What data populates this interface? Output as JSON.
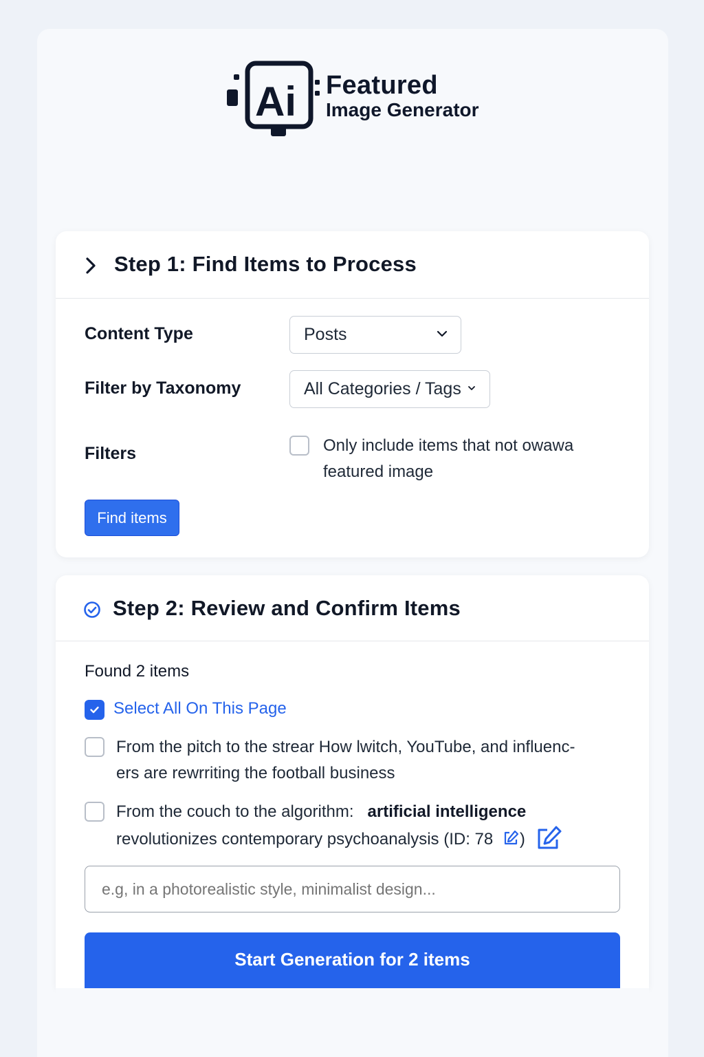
{
  "logo": {
    "line1": "Featured",
    "line2": "Image Generator",
    "mark_text": "Ai"
  },
  "step1": {
    "title": "Step 1: Find Items to Process",
    "content_type_label": "Content Type",
    "content_type_value": "Posts",
    "taxonomy_label": "Filter by Taxonomy",
    "taxonomy_value": "All Categories / Tags",
    "filters_label": "Filters",
    "filter_option_line1": "Only include items that not owawa",
    "filter_option_line2": "featured image",
    "filter_option_checked": false,
    "find_button": "Find items"
  },
  "step2": {
    "title": "Step 2: Review and Confirm Items",
    "found_text": "Found 2 items",
    "select_all_label": "Select All On This Page",
    "select_all_checked": true,
    "items": [
      {
        "line1": "From the pitch to the strear How lwitch, YouTube,  and influenc-",
        "line2": "ers are rewrriting the football business",
        "checked": false
      },
      {
        "line1_a": "From the couch to the algorithm:",
        "line1_b": "artificial intelligence",
        "line2": "revolutionizes contemporary psychoanalysis (ID: 78",
        "line2_end": ")",
        "checked": false
      }
    ],
    "prompt_placeholder": "e.g, in a photorealistic style, minimalist design...",
    "start_button": "Start Generation for 2 items"
  },
  "colors": {
    "accent": "#2563eb",
    "page_bg": "#eef2f8",
    "card_bg": "#ffffff"
  }
}
